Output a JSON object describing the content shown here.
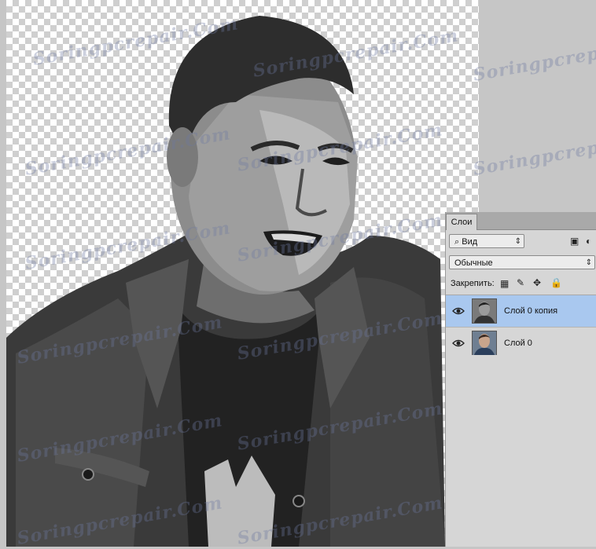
{
  "layers_panel": {
    "tab_label": "Слои",
    "filter_kind": "Вид",
    "blend_mode": "Обычные",
    "lock_label": "Закрепить:",
    "layers": [
      {
        "name": "Слой 0 копия",
        "selected": true,
        "visible": true
      },
      {
        "name": "Слой 0",
        "selected": false,
        "visible": true
      }
    ]
  },
  "watermark": "Soringpcrepair.Com",
  "colors": {
    "selection": "#a9c8ef",
    "panel_bg": "#d6d6d6",
    "workspace": "#c6c6c6"
  }
}
